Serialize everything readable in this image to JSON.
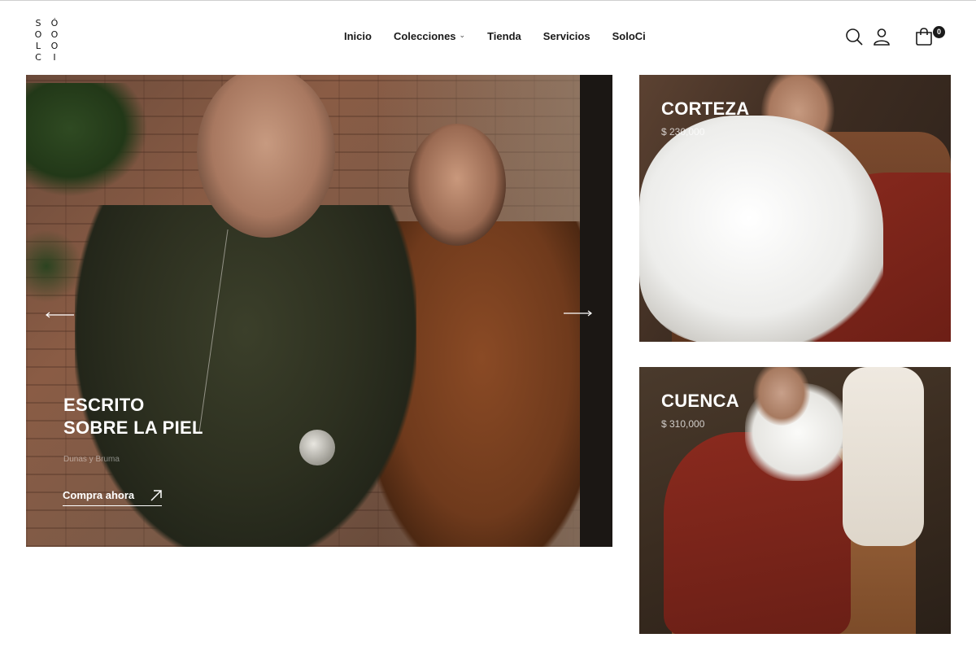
{
  "brand": {
    "logo_letters": [
      "S",
      "Ó",
      "O",
      "O",
      "L",
      "O",
      "C",
      "I"
    ]
  },
  "nav": {
    "items": [
      {
        "label": "Inicio",
        "has_dropdown": false
      },
      {
        "label": "Colecciones",
        "has_dropdown": true
      },
      {
        "label": "Tienda",
        "has_dropdown": false
      },
      {
        "label": "Servicios",
        "has_dropdown": false
      },
      {
        "label": "SoloCi",
        "has_dropdown": false
      }
    ]
  },
  "header_icons": {
    "search": "search-icon",
    "account": "user-icon",
    "cart": "shopping-bag-icon",
    "cart_count": "0"
  },
  "hero": {
    "title_line1": "ESCRITO",
    "title_line2": "SOBRE LA PIEL",
    "subtitle": "Dunas y Bruma",
    "cta_label": "Compra ahora",
    "prev_icon": "arrow-left-icon",
    "next_icon": "arrow-right-icon"
  },
  "products": [
    {
      "name": "CORTEZA",
      "price": "$ 230,000"
    },
    {
      "name": "CUENCA",
      "price": "$ 310,000"
    }
  ],
  "colors": {
    "text": "#1a1a1a",
    "overlay_text": "#ffffff",
    "badge_bg": "#1a1a1a"
  }
}
